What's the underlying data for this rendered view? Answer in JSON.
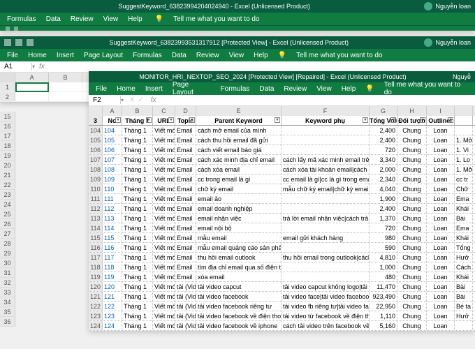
{
  "win1": {
    "title": "SuggestKeyword_63823994204024940 - Excel (Unlicensed Product)",
    "user": "Nguyễn loan",
    "tabs": [
      "Formulas",
      "Data",
      "Review",
      "View",
      "Help"
    ],
    "tell": "Tell me what you want to do"
  },
  "win2": {
    "title": "SuggestKeyword_63823993531317912  [Protected View] - Excel (Unlicensed Product)",
    "user": "Nguyễn loan",
    "tabs": [
      "File",
      "Home",
      "Insert",
      "Page Layout",
      "Formulas",
      "Data",
      "Review",
      "View",
      "Help"
    ],
    "tell": "Tell me what you want to do",
    "namebox": "A1",
    "cols": [
      "A",
      "B"
    ],
    "rowhdrs": [
      "1",
      "2"
    ]
  },
  "win3": {
    "title": "MONITOR_HRI_NEXTOP_SEO_2024  [Protected View] [Repaired] - Excel (Unlicensed Product)",
    "user": "Nguyễ",
    "tabs": [
      "File",
      "Home",
      "Insert",
      "Page Layout",
      "Formulas",
      "Data",
      "Review",
      "View",
      "Help"
    ],
    "tell": "Tell me what you want to do",
    "namebox": "F2",
    "colletters": [
      "A",
      "B",
      "C",
      "D",
      "E",
      "F",
      "G",
      "H",
      "I"
    ],
    "headers": [
      "No",
      "Tháng 1",
      "URL",
      "Topic",
      "Parent Keyword",
      "Keyword phụ",
      "Tổng Volume",
      "Đối tượn",
      "Outliner"
    ],
    "rowstart": 4,
    "extras": [
      "",
      "1. Mở",
      "1. Vi",
      "1. Lo",
      "1. Mở",
      "cc tr",
      "Chữ",
      "Ema",
      "Khái",
      "Bài",
      "Ema",
      "Khái",
      "Tổng",
      "Hưở",
      "Cách",
      "Khái",
      "Bài",
      "Bài",
      "Bé ta",
      "Hưở"
    ],
    "rows": [
      {
        "r": "104",
        "no": "104",
        "th": "Tháng 1",
        "url": "Viết mới",
        "topic": "Email",
        "pk": "cách mở email của mình",
        "kp": "",
        "vol": "2,400",
        "dt": "Chung",
        "ol": "Loan"
      },
      {
        "r": "105",
        "no": "105",
        "th": "Tháng 1",
        "url": "Viết mới",
        "topic": "Email",
        "pk": "cách thu hồi email đã gửi",
        "kp": "",
        "vol": "2,400",
        "dt": "Chung",
        "ol": "Loan"
      },
      {
        "r": "106",
        "no": "106",
        "th": "Tháng 1",
        "url": "Viết mới",
        "topic": "Email",
        "pk": "cách viết email báo giá",
        "kp": "",
        "vol": "720",
        "dt": "Chung",
        "ol": "Loan"
      },
      {
        "r": "107",
        "no": "107",
        "th": "Tháng 1",
        "url": "Viết mới",
        "topic": "Email",
        "pk": "cách xác minh địa chỉ email",
        "kp": "cách lấy mã xác minh email trên đ",
        "vol": "3,340",
        "dt": "Chung",
        "ol": "Loan"
      },
      {
        "r": "108",
        "no": "108",
        "th": "Tháng 1",
        "url": "Viết mới",
        "topic": "Email",
        "pk": "cách xóa email",
        "kp": "cách xóa tài khoản email|cách xóa",
        "vol": "2,000",
        "dt": "Chung",
        "ol": "Loan"
      },
      {
        "r": "109",
        "no": "109",
        "th": "Tháng 1",
        "url": "Viết mới",
        "topic": "Email",
        "pk": "cc trong email là gì",
        "kp": "cc email là gì|cc là gì trong email",
        "vol": "2,340",
        "dt": "Chung",
        "ol": "Loan"
      },
      {
        "r": "110",
        "no": "110",
        "th": "Tháng 1",
        "url": "Viết mới",
        "topic": "Email",
        "pk": "chữ ký email",
        "kp": "mẫu chữ ký email|chữ ký email ch",
        "vol": "4,040",
        "dt": "Chung",
        "ol": "Loan"
      },
      {
        "r": "111",
        "no": "111",
        "th": "Tháng 1",
        "url": "Viết mới",
        "topic": "Email",
        "pk": "email ảo",
        "kp": "",
        "vol": "1,900",
        "dt": "Chung",
        "ol": "Loan"
      },
      {
        "r": "112",
        "no": "112",
        "th": "Tháng 1",
        "url": "Viết mới",
        "topic": "Email",
        "pk": "email doanh nghiệp",
        "kp": "",
        "vol": "2,400",
        "dt": "Chung",
        "ol": "Loan"
      },
      {
        "r": "113",
        "no": "113",
        "th": "Tháng 1",
        "url": "Viết mới",
        "topic": "Email",
        "pk": "email nhận việc",
        "kp": "trả lời email nhận việc|cách trả lời",
        "vol": "1,370",
        "dt": "Chung",
        "ol": "Loan"
      },
      {
        "r": "114",
        "no": "114",
        "th": "Tháng 1",
        "url": "Viết mới",
        "topic": "Email",
        "pk": "email nội bộ",
        "kp": "",
        "vol": "720",
        "dt": "Chung",
        "ol": "Loan"
      },
      {
        "r": "115",
        "no": "115",
        "th": "Tháng 1",
        "url": "Viết mới",
        "topic": "Email",
        "pk": "mẫu email",
        "kp": "email gửi khách hàng",
        "vol": "980",
        "dt": "Chung",
        "ol": "Loan"
      },
      {
        "r": "116",
        "no": "116",
        "th": "Tháng 1",
        "url": "Viết mới",
        "topic": "Email",
        "pk": "mẫu email quảng cáo sản phẩm",
        "kp": "",
        "vol": "590",
        "dt": "Chung",
        "ol": "Loan"
      },
      {
        "r": "117",
        "no": "117",
        "th": "Tháng 1",
        "url": "Viết mới",
        "topic": "Email",
        "pk": "thu hồi email outlook",
        "kp": "thu hồi email trong outlook|cách th",
        "vol": "4,810",
        "dt": "Chung",
        "ol": "Loan"
      },
      {
        "r": "118",
        "no": "118",
        "th": "Tháng 1",
        "url": "Viết mới",
        "topic": "Email",
        "pk": "tìm địa chỉ email qua số điện thoại",
        "kp": "",
        "vol": "1,000",
        "dt": "Chung",
        "ol": "Loan"
      },
      {
        "r": "119",
        "no": "119",
        "th": "Tháng 1",
        "url": "Viết mới",
        "topic": "Email",
        "pk": "xóa email",
        "kp": "",
        "vol": "480",
        "dt": "Chung",
        "ol": "Loan"
      },
      {
        "r": "120",
        "no": "120",
        "th": "Tháng 1",
        "url": "Viết mới",
        "topic": "tải (Video",
        "pk": "tải video capcut",
        "kp": "tải video capcut không logo|tải vide",
        "vol": "11,470",
        "dt": "Chung",
        "ol": "Loan"
      },
      {
        "r": "121",
        "no": "121",
        "th": "Tháng 1",
        "url": "Viết mới",
        "topic": "tải (Video",
        "pk": "tải video facebook",
        "kp": "tải video face|tải video facebook|c",
        "vol": "923,490",
        "dt": "Chung",
        "ol": "Loan"
      },
      {
        "r": "122",
        "no": "122",
        "th": "Tháng 1",
        "url": "Viết mới",
        "topic": "tải (Video",
        "pk": "tải video facebook riêng tư",
        "kp": "tải video fb riêng tư|tải video faceb",
        "vol": "22,950",
        "dt": "Chung",
        "ol": "Loan"
      },
      {
        "r": "123",
        "no": "123",
        "th": "Tháng 1",
        "url": "Viết mới",
        "topic": "tải (Video",
        "pk": "tải video facebook về điện thoại andro",
        "kp": "tải video từ facebook về điện thoại",
        "vol": "1,110",
        "dt": "Chung",
        "ol": "Loan"
      },
      {
        "r": "124",
        "no": "124",
        "th": "Tháng 1",
        "url": "Viết mới",
        "topic": "tải (Video",
        "pk": "tải video facebook về iphone",
        "kp": "cách tải video trên facebook về điệ",
        "vol": "5,160",
        "dt": "Chung",
        "ol": "Loan"
      }
    ]
  }
}
